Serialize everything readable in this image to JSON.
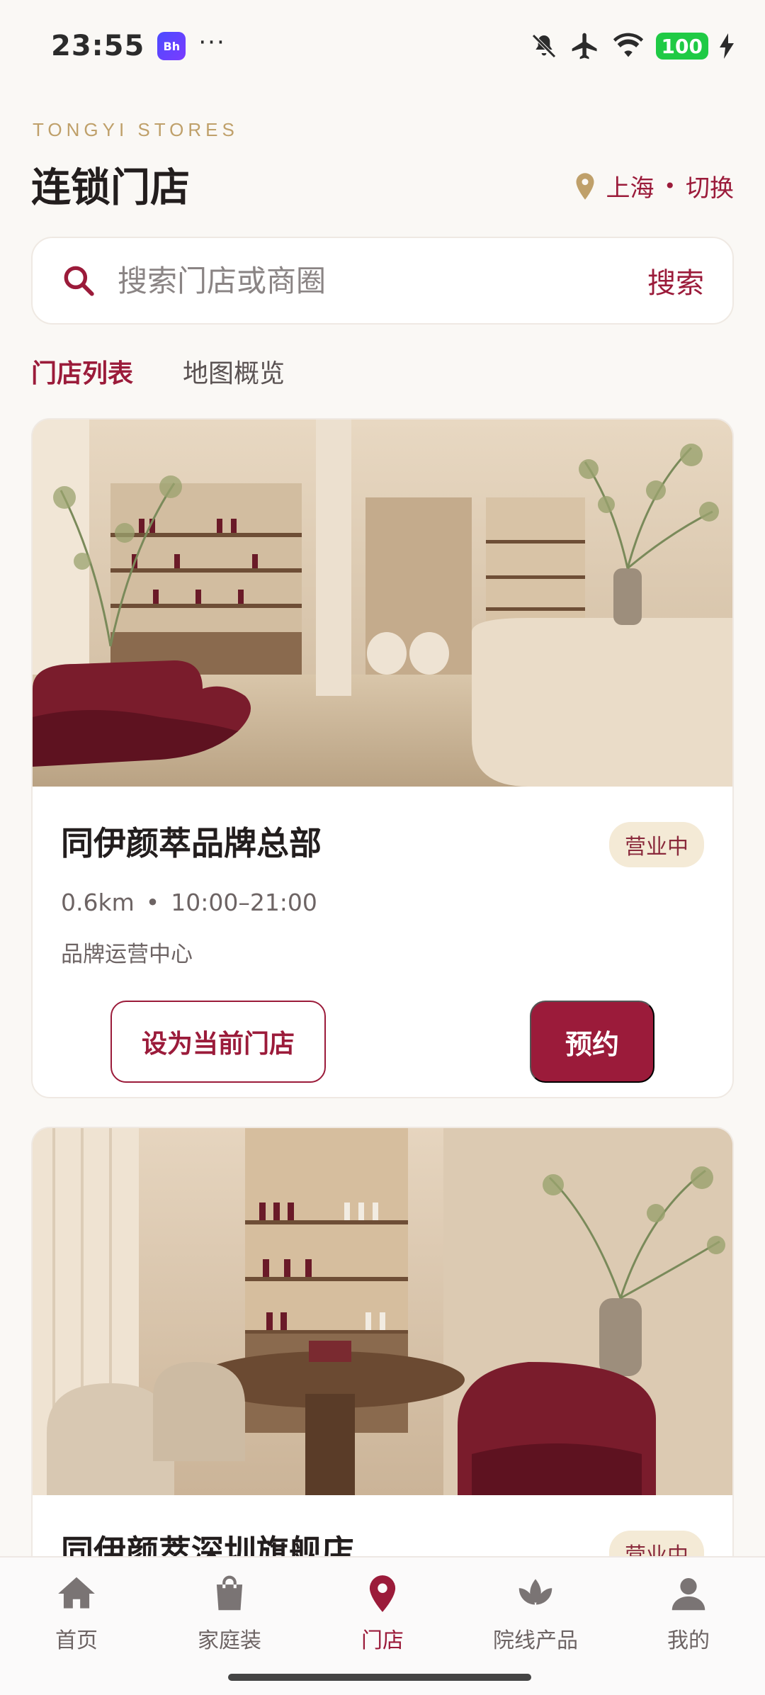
{
  "status_bar": {
    "time": "23:55",
    "app_badge": "Bh",
    "dots": "···",
    "battery": "100"
  },
  "header": {
    "brand_sub": "TONGYI STORES",
    "title": "连锁门店",
    "city": "上海",
    "switch": "切换",
    "separator": "•"
  },
  "search": {
    "placeholder": "搜索门店或商圈",
    "button": "搜索"
  },
  "tabs": [
    {
      "label": "门店列表",
      "active": true
    },
    {
      "label": "地图概览",
      "active": false
    }
  ],
  "stores": [
    {
      "name": "同伊颜萃品牌总部",
      "status": "营业中",
      "distance": "0.6km",
      "hours": "10:00–21:00",
      "desc": "品牌运营中心",
      "set_current_label": "设为当前门店",
      "book_label": "预约"
    },
    {
      "name": "同伊颜萃深圳旗舰店",
      "status": "营业中"
    }
  ],
  "nav": [
    {
      "label": "首页",
      "icon": "home-icon"
    },
    {
      "label": "家庭装",
      "icon": "shopping-bag-icon"
    },
    {
      "label": "门店",
      "icon": "map-pin-icon",
      "active": true
    },
    {
      "label": "院线产品",
      "icon": "lotus-icon"
    },
    {
      "label": "我的",
      "icon": "user-icon"
    }
  ],
  "colors": {
    "accent": "#9b1b3a",
    "gold": "#bfa06a",
    "badge_bg": "#f4ead6"
  }
}
